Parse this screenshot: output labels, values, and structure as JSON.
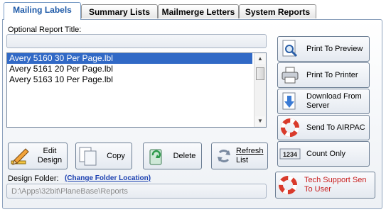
{
  "tabs": [
    {
      "label": "Mailing Labels",
      "active": true
    },
    {
      "label": "Summary Lists",
      "active": false
    },
    {
      "label": "Mailmerge Letters",
      "active": false
    },
    {
      "label": "System Reports",
      "active": false
    }
  ],
  "report_title": {
    "label": "Optional Report Title:",
    "value": ""
  },
  "label_list": {
    "items": [
      "Avery 5160 30 Per Page.lbl",
      "Avery 5161 20 Per Page.lbl",
      "Avery 5163 10 Per Page.lbl"
    ],
    "selected": "Avery 5160 30 Per Page.lbl"
  },
  "actions": {
    "edit_design_1": "Edit",
    "edit_design_2": "Design",
    "copy": "Copy",
    "delete": "Delete",
    "refresh_1": "Refresh",
    "refresh_2": "List"
  },
  "design_folder": {
    "label": "Design Folder:",
    "change_link": "(Change Folder Location)",
    "path": "D:\\Apps\\32bit\\PlaneBase\\Reports"
  },
  "right_buttons": {
    "preview": "Print To Preview",
    "printer": "Print To Printer",
    "download_1": "Download From",
    "download_2": "Server",
    "airpac": "Send To AIRPAC",
    "count_only": "Count Only",
    "count_icon_text": "1234",
    "tech_1": "Tech Support Sen",
    "tech_2": "To User"
  },
  "colors": {
    "accent": "#1e5aa8",
    "selection": "#3169c6",
    "link": "#1a3fb0",
    "warning_text": "#c81e1e"
  }
}
